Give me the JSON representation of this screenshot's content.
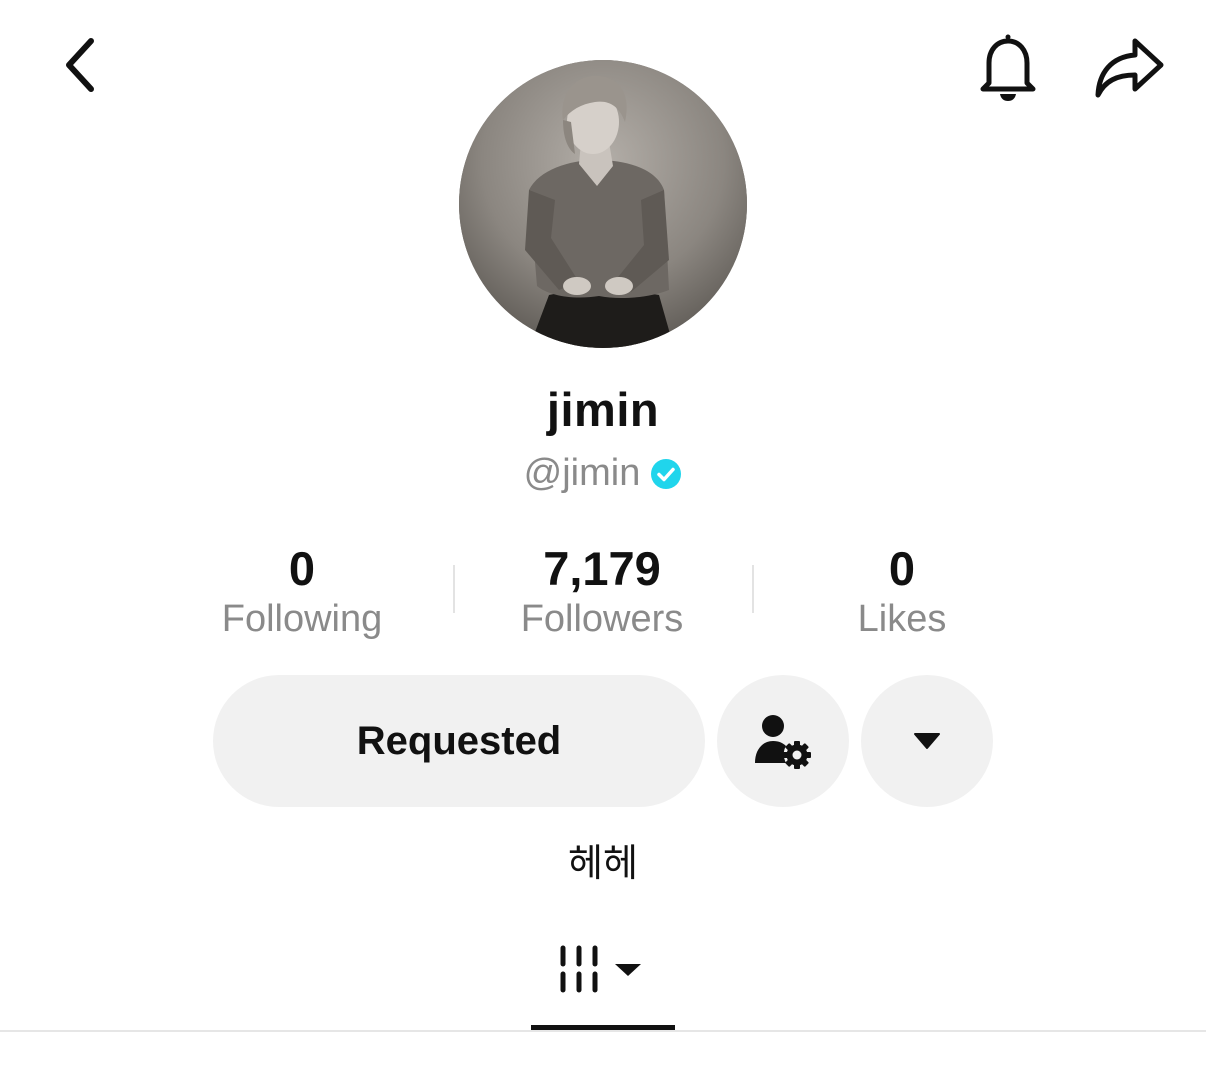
{
  "header": {
    "back_icon": "chevron-left-icon",
    "bell_icon": "bell-icon",
    "share_icon": "share-arrow-icon"
  },
  "profile": {
    "display_name": "jimin",
    "handle": "@jimin",
    "verified": true,
    "verified_color": "#20D5EC",
    "bio": "헤헤"
  },
  "stats": [
    {
      "value": "0",
      "label": "Following"
    },
    {
      "value": "7,179",
      "label": "Followers"
    },
    {
      "value": "0",
      "label": "Likes"
    }
  ],
  "actions": {
    "requested_label": "Requested",
    "user_settings_icon": "user-gear-icon",
    "more_icon": "caret-down-icon"
  },
  "tabs": {
    "active_icon": "videos-grid-icon"
  }
}
